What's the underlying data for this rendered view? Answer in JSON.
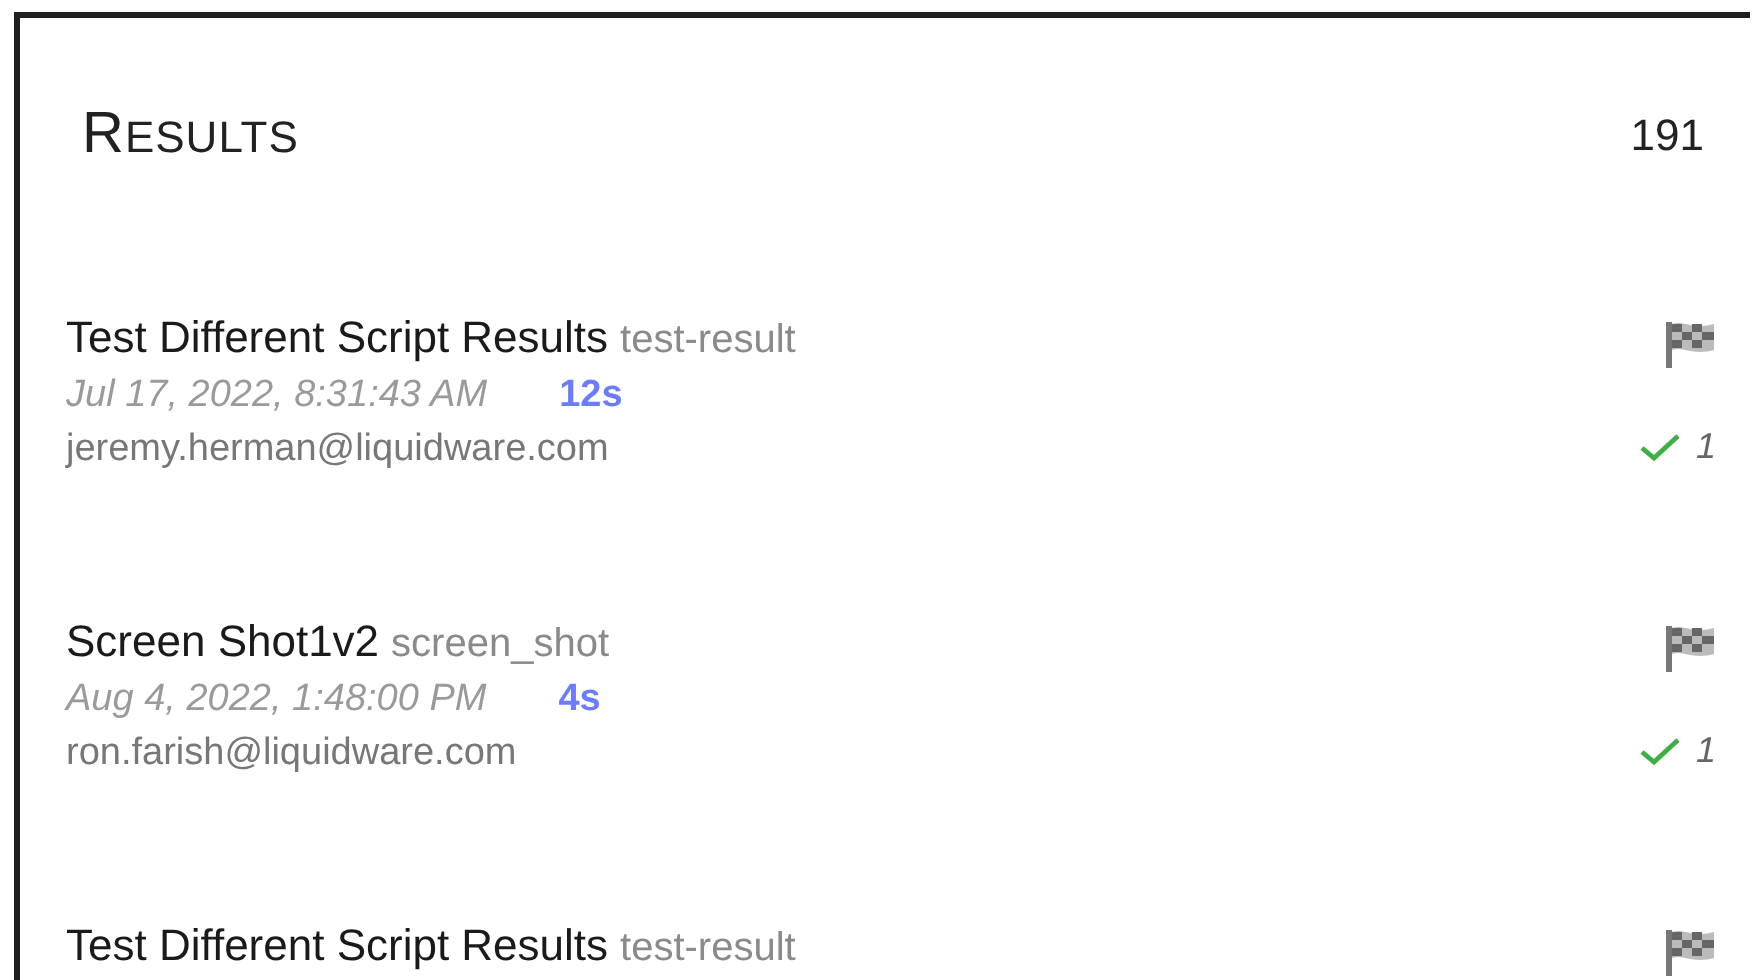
{
  "header": {
    "title": "RESULTS",
    "count": "191"
  },
  "results": [
    {
      "name": "Test Different Script Results",
      "type": "test-result",
      "date": "Jul 17, 2022, 8:31:43 AM",
      "duration": "12s",
      "user": "jeremy.herman@liquidware.com",
      "passed": "1"
    },
    {
      "name": "Screen Shot1v2",
      "type": "screen_shot",
      "date": "Aug 4, 2022, 1:48:00 PM",
      "duration": "4s",
      "user": "ron.farish@liquidware.com",
      "passed": "1"
    },
    {
      "name": "Test Different Script Results",
      "type": "test-result"
    }
  ]
}
